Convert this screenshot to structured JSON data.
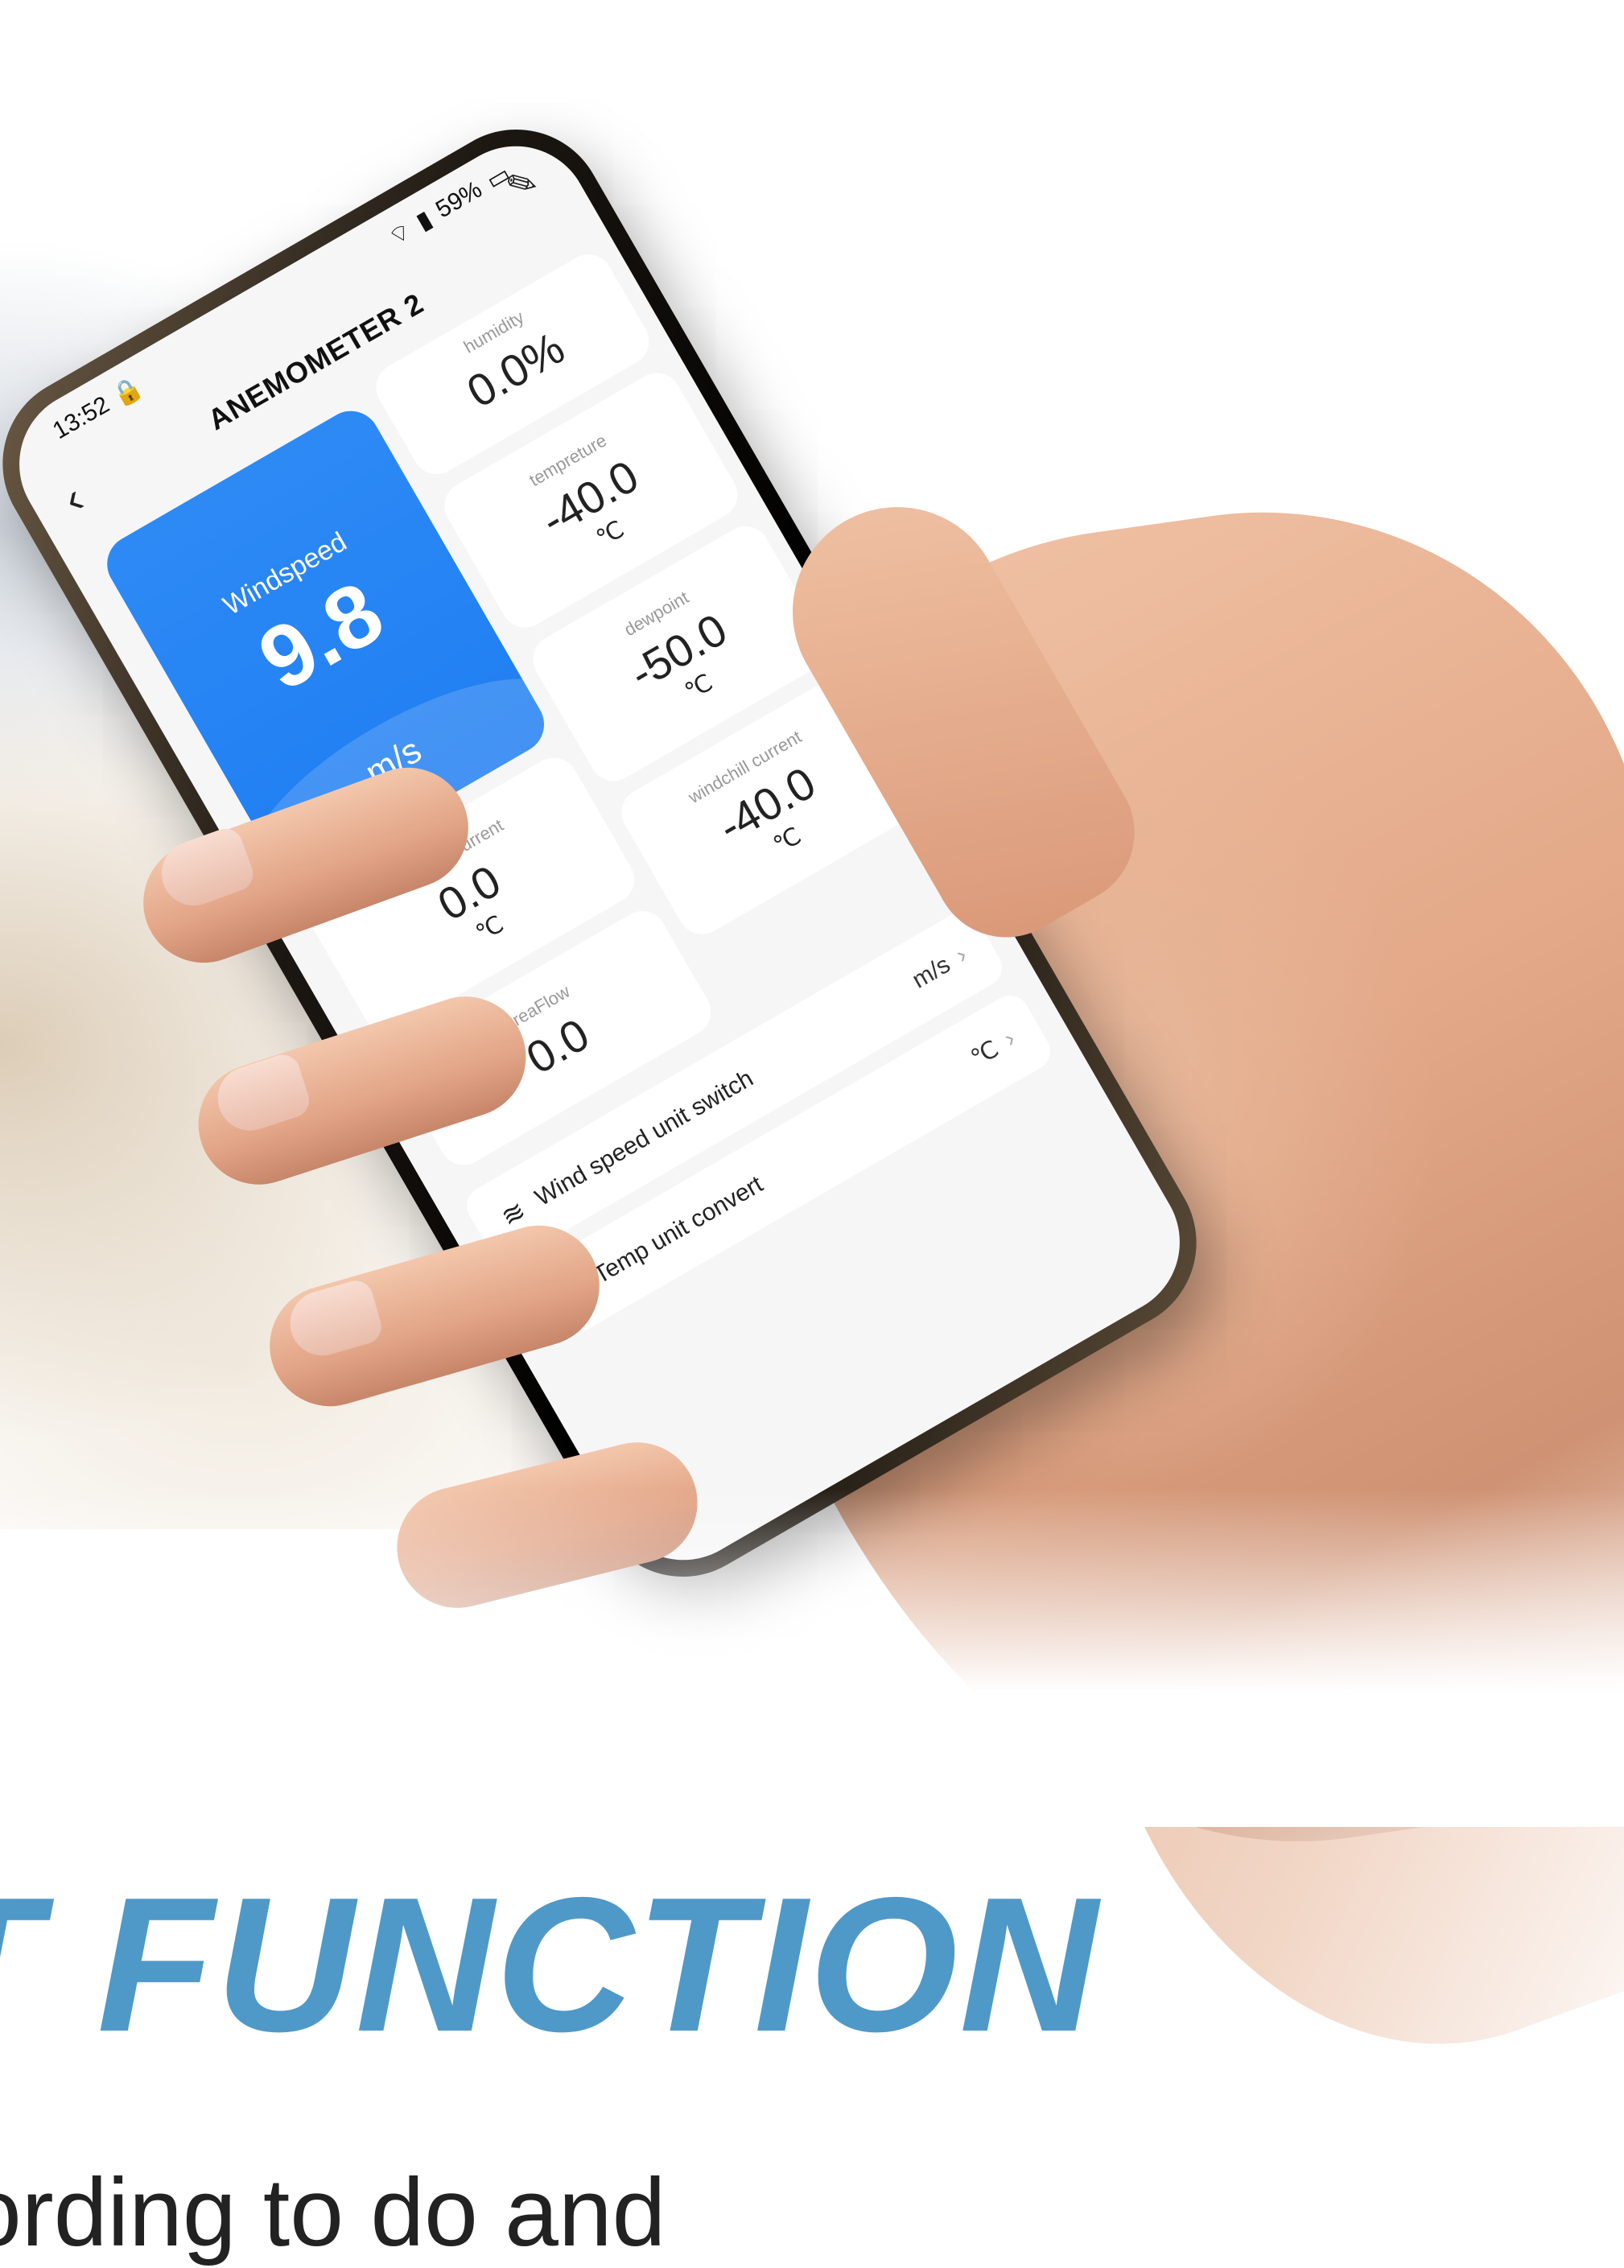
{
  "status_bar": {
    "time": "13:52",
    "lock_icon": "lock-icon",
    "battery": "59%"
  },
  "nav": {
    "title": "ANEMOMETER 2",
    "back_icon": "chevron-left-icon",
    "edit_icon": "edit-pencil-icon"
  },
  "windspeed": {
    "label": "Windspeed",
    "value": "9.8",
    "unit": "m/s"
  },
  "tiles": {
    "humidity": {
      "label": "humidity",
      "value": "0.0%"
    },
    "temperature": {
      "label": "tempreture",
      "value": "-40.0",
      "unit": "℃"
    },
    "dewpoint": {
      "label": "dewpoint",
      "value": "-50.0",
      "unit": "℃"
    },
    "wetball": {
      "label": "Wet Ball current",
      "value": "0.0",
      "unit": "℃"
    },
    "windchill": {
      "label": "windchill current",
      "value": "-40.0",
      "unit": "℃"
    },
    "areaflow": {
      "label": "AreaFlow",
      "value": "0.0"
    }
  },
  "settings": {
    "wind_unit": {
      "label": "Wind speed unit switch",
      "value": "m/s"
    },
    "temp_unit": {
      "label": "Temp unit convert",
      "value": "℃"
    }
  },
  "headline": {
    "text": "T FUNCTION",
    "subtext": "ording to do and"
  },
  "colors": {
    "accent_blue": "#1f7ef2",
    "headline_blue": "#4f99c8"
  }
}
